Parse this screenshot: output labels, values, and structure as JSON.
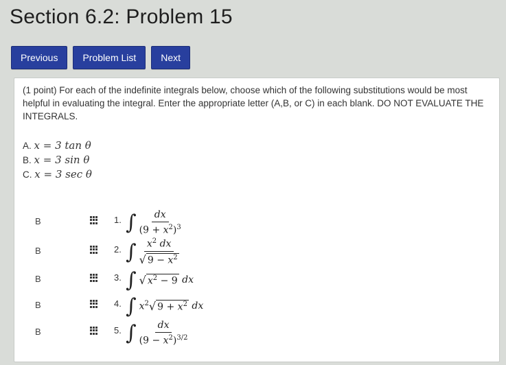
{
  "title": "Section 6.2: Problem 15",
  "nav": {
    "previous": "Previous",
    "problem_list": "Problem List",
    "next": "Next"
  },
  "prompt": "(1 point) For each of the indefinite integrals below, choose which of the following substitutions would be most helpful in evaluating the integral. Enter the appropriate letter (A,B, or C) in each blank. DO NOT EVALUATE THE INTEGRALS.",
  "options": [
    {
      "letter": "A.",
      "sub": "x = 3 tan θ"
    },
    {
      "letter": "B.",
      "sub": "x = 3 sin θ"
    },
    {
      "letter": "C.",
      "sub": "x = 3 sec θ"
    }
  ],
  "questions": [
    {
      "number": "1.",
      "answer": "B"
    },
    {
      "number": "2.",
      "answer": "B"
    },
    {
      "number": "3.",
      "answer": "B"
    },
    {
      "number": "4.",
      "answer": "B"
    },
    {
      "number": "5.",
      "answer": "B"
    }
  ],
  "colors": {
    "button": "#283f9e",
    "background": "#d9dcd8",
    "panel": "#ffffff"
  },
  "icons": {
    "answer_menu": "grid-icon"
  }
}
